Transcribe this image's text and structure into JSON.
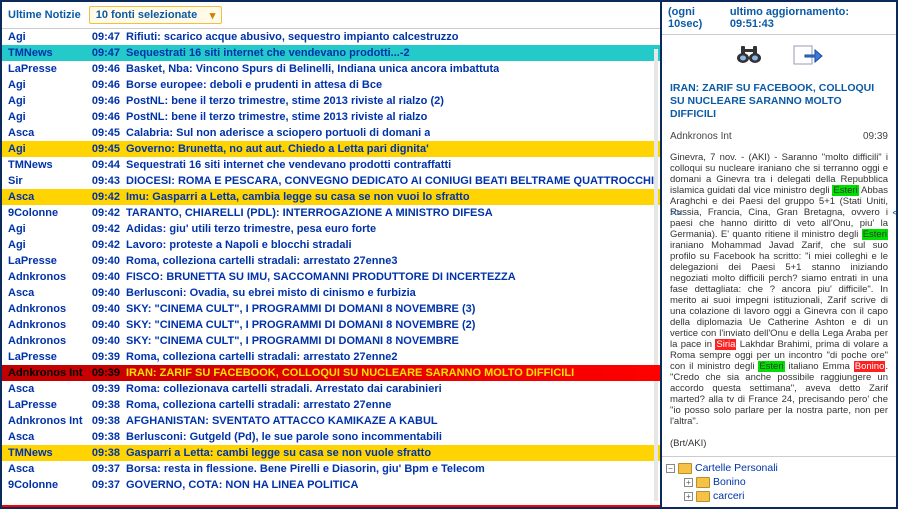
{
  "topbar": {
    "label": "Ultime Notizie",
    "dropdown": "10 fonti selezionate"
  },
  "right": {
    "refresh": "(ogni 10sec)",
    "updated_label": "ultimo aggiornamento:",
    "updated_time": "09:51:43",
    "detail_title": "IRAN: ZARIF SU FACEBOOK, COLLOQUI SU NUCLEARE SARANNO MOLTO DIFFICILI",
    "detail_source": "Adnkronos Int",
    "detail_time": "09:39",
    "detail_body": "Ginevra, 7 nov. - (AKI) - Saranno \"molto difficili\" i colloqui su nucleare iraniano che si terranno oggi e domani a Ginevra tra i delegati della Repubblica islamica guidati dal vice ministro degli |HL|Esteri|/HL| Abbas Araghchi e dei Paesi del gruppo 5+1 (Stati Uniti, Russia, Francia, Cina, Gran Bretagna, ovvero i paesi che hanno diritto di veto all'Onu, piu' la Germania). E' quanto ritiene il ministro degli |HL|Esteri|/HL| iraniano Mohammad Javad Zarif, che sul suo profilo su Facebook ha scritto: \"i miei colleghi e le delegazioni dei Paesi 5+1 stanno iniziando negoziati molto difficili perch? siamo entrati in una fase dettagliata: che ? ancora piu' difficile\". In merito ai suoi impegni istituzionali, Zarif scrive di una colazione di lavoro oggi a Ginevra con il capo della diplomazia Ue Catherine Ashton e di un vertice con l'inviato dell'Onu e della Lega Araba per la pace in |HLR|Siria|/HLR| Lakhdar Brahimi, prima di volare a Roma sempre oggi per un incontro \"di poche ore\" con il ministro degli |HL|Esteri|/HL| italiano Emma |HLR|Bonino|/HLR|. \"Credo che sia anche possibile raggiungere un accordo questa settimana\", aveva detto Zarif marted? alla tv di France 24, precisando pero' che \"io posso solo parlare per la nostra parte, non per l'altra\".",
    "detail_sign": "(Brt/AKI)"
  },
  "tree": {
    "root": "Cartelle Personali",
    "items": [
      "Bonino",
      "carceri"
    ]
  },
  "news": [
    {
      "source": "Agi",
      "time": "09:47",
      "title": "Rifiuti: scarico acque abusivo, sequestro impianto calcestruzzo"
    },
    {
      "source": "TMNews",
      "time": "09:47",
      "title": "Sequestrati 16 siti internet che vendevano prodotti...-2",
      "bg": "cyan"
    },
    {
      "source": "LaPresse",
      "time": "09:46",
      "title": "Basket, Nba: Vincono Spurs di Belinelli, Indiana unica ancora imbattuta"
    },
    {
      "source": "Agi",
      "time": "09:46",
      "title": "Borse europee: deboli e prudenti in attesa di Bce"
    },
    {
      "source": "Agi",
      "time": "09:46",
      "title": "PostNL: bene il terzo trimestre, stime 2013 riviste al rialzo (2)"
    },
    {
      "source": "Agi",
      "time": "09:46",
      "title": "PostNL: bene il terzo trimestre, stime 2013 riviste al rialzo"
    },
    {
      "source": "Asca",
      "time": "09:45",
      "title": "Calabria: Sul non aderisce a sciopero portuoli di domani a"
    },
    {
      "source": "Agi",
      "time": "09:45",
      "title": "Governo: Brunetta, no aut aut. Chiedo a Letta pari dignita'",
      "bg": "yellow"
    },
    {
      "source": "TMNews",
      "time": "09:44",
      "title": "Sequestrati 16 siti internet che vendevano prodotti contraffatti"
    },
    {
      "source": "Sir",
      "time": "09:43",
      "title": "DIOCESI: ROMA E PESCARA, CONVEGNO DEDICATO AI CONIUGI BEATI BELTRAME QUATTROCCHI"
    },
    {
      "source": "Asca",
      "time": "09:42",
      "title": "Imu: Gasparri a Letta, cambia legge su casa se non vuoi lo sfratto",
      "bg": "yellow"
    },
    {
      "source": "9Colonne",
      "time": "09:42",
      "title": "TARANTO, CHIARELLI (PDL): INTERROGAZIONE A MINISTRO DIFESA"
    },
    {
      "source": "Agi",
      "time": "09:42",
      "title": "Adidas: giu' utili terzo trimestre, pesa euro forte"
    },
    {
      "source": "Agi",
      "time": "09:42",
      "title": "Lavoro: proteste a Napoli e blocchi stradali"
    },
    {
      "source": "LaPresse",
      "time": "09:40",
      "title": "Roma, colleziona cartelli stradali: arrestato 27enne3"
    },
    {
      "source": "Adnkronos",
      "time": "09:40",
      "title": "FISCO: BRUNETTA SU IMU, SACCOMANNI PRODUTTORE DI INCERTEZZA"
    },
    {
      "source": "Asca",
      "time": "09:40",
      "title": "Berlusconi: Ovadia, su ebrei misto di cinismo e furbizia"
    },
    {
      "source": "Adnkronos",
      "time": "09:40",
      "title": "SKY: \"CINEMA CULT\", I PROGRAMMI DI DOMANI 8 NOVEMBRE (3)"
    },
    {
      "source": "Adnkronos",
      "time": "09:40",
      "title": "SKY: \"CINEMA CULT\", I PROGRAMMI DI DOMANI 8 NOVEMBRE (2)"
    },
    {
      "source": "Adnkronos",
      "time": "09:40",
      "title": "SKY: \"CINEMA CULT\", I PROGRAMMI DI DOMANI 8 NOVEMBRE"
    },
    {
      "source": "LaPresse",
      "time": "09:39",
      "title": "Roma, colleziona cartelli stradali: arrestato 27enne2"
    },
    {
      "source": "Adnkronos Int",
      "time": "09:39",
      "title": "IRAN: ZARIF SU FACEBOOK, COLLOQUI SU NUCLEARE SARANNO MOLTO DIFFICILI",
      "highlight": true
    },
    {
      "source": "Asca",
      "time": "09:39",
      "title": "Roma: collezionava cartelli stradali. Arrestato dai carabinieri"
    },
    {
      "source": "LaPresse",
      "time": "09:38",
      "title": "Roma, colleziona cartelli stradali: arrestato 27enne"
    },
    {
      "source": "Adnkronos Int",
      "time": "09:38",
      "title": "AFGHANISTAN: SVENTATO ATTACCO KAMIKAZE A KABUL"
    },
    {
      "source": "Asca",
      "time": "09:38",
      "title": "Berlusconi: Gutgeld (Pd), le sue parole sono incommentabili"
    },
    {
      "source": "TMNews",
      "time": "09:38",
      "title": "Gasparri a Letta: cambi legge su casa se non vuole sfratto",
      "bg": "yellow"
    },
    {
      "source": "Asca",
      "time": "09:37",
      "title": "Borsa: resta in flessione. Bene Pirelli e Diasorin, giu' Bpm e Telecom"
    },
    {
      "source": "9Colonne",
      "time": "09:37",
      "title": "GOVERNO, COTA: NON HA LINEA POLITICA"
    }
  ]
}
